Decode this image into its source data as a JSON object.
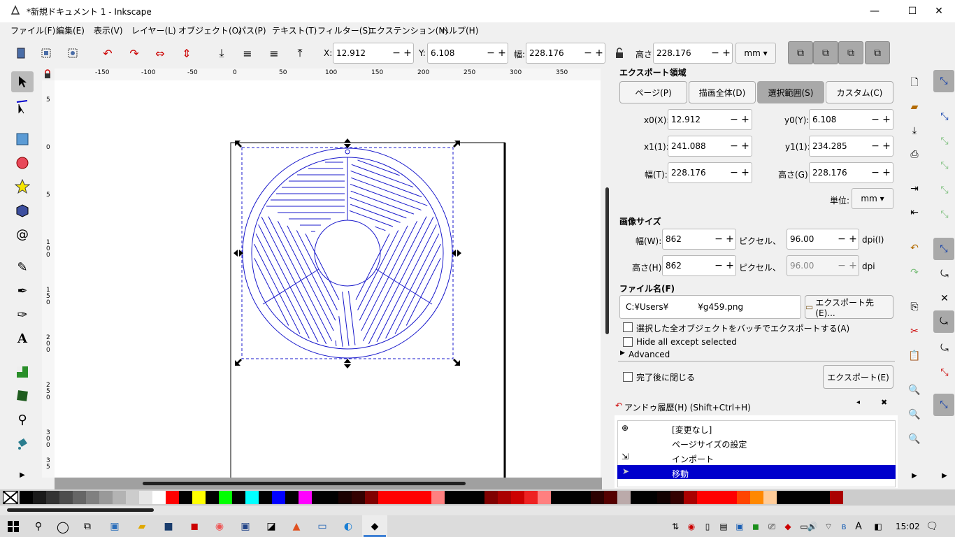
{
  "window": {
    "title": "*新規ドキュメント 1 - Inkscape",
    "minimize": "—",
    "maximize": "☐",
    "close": "✕"
  },
  "menu": [
    "ファイル(F)",
    "編集(E)",
    "表示(V)",
    "レイヤー(L)",
    "オブジェクト(O)",
    "パス(P)",
    "テキスト(T)",
    "フィルター(S)",
    "エクステンション(N)",
    "ヘルプ(H)"
  ],
  "toolbar": {
    "x_label": "X:",
    "x_value": "12.912",
    "y_label": "Y:",
    "y_value": "6.108",
    "w_label": "幅:",
    "w_value": "228.176",
    "h_label": "高さ:",
    "h_value": "228.176",
    "unit": "mm",
    "minus": "−",
    "plus": "+"
  },
  "rulers": {
    "top": [
      "-150",
      "-100",
      "-50",
      "0",
      "50",
      "100",
      "150",
      "200",
      "250",
      "300",
      "350"
    ],
    "left": [
      "5",
      "0",
      "5",
      "1\n0\n0",
      "1\n5\n0",
      "2\n0\n0",
      "2\n5\n0",
      "3\n0\n0",
      "3\n5"
    ]
  },
  "export_dialog": {
    "area_title": "エクスポート領域",
    "area_buttons": [
      "ページ(P)",
      "描画全体(D)",
      "選択範囲(S)",
      "カスタム(C)"
    ],
    "selected_area": "選択範囲(S)",
    "x0_label": "x0(X):",
    "x0_value": "12.912",
    "y0_label": "y0(Y):",
    "y0_value": "6.108",
    "x1_label": "x1(1):",
    "x1_value": "241.088",
    "y1_label": "y1(1):",
    "y1_value": "234.285",
    "width_label": "幅(T):",
    "width_value": "228.176",
    "height_label": "高さ(G):",
    "height_value": "228.176",
    "unit_label": "単位:",
    "unit_value": "mm",
    "image_size_title": "画像サイズ",
    "img_w_label": "幅(W):",
    "img_w_value": "862",
    "px_label_1": "ピクセル、",
    "dpi_value": "96.00",
    "dpi_label": "dpi(I)",
    "img_h_label": "高さ(H):",
    "img_h_value": "862",
    "px_label_2": "ピクセル、",
    "dpi_value_2": "96.00",
    "dpi_label_2": "dpi",
    "filename_title": "ファイル名(F)",
    "filename_value": "C:¥Users¥           ¥g459.png",
    "export_as_button": "エクスポート先(E)...",
    "batch_label": "選択した全オブジェクトをバッチでエクスポートする(A)",
    "hide_label": "Hide all except selected",
    "advanced_label": "Advanced",
    "close_after_label": "完了後に閉じる",
    "export_button": "エクスポート(E)"
  },
  "undo_history": {
    "title": "アンドゥ履歴(H) (Shift+Ctrl+H)",
    "items": [
      "[変更なし]",
      "ページサイズの設定",
      "インポート",
      "移動"
    ],
    "selected_index": 3
  },
  "palette_colors": [
    "#000000",
    "#1a1a1a",
    "#333333",
    "#4d4d4d",
    "#666666",
    "#808080",
    "#999999",
    "#b3b3b3",
    "#cccccc",
    "#e6e6e6",
    "#ffffff",
    "#ff0000",
    "#000000",
    "#ffff00",
    "#000000",
    "#00ff00",
    "#000000",
    "#00ffff",
    "#000000",
    "#0000ff",
    "#000000",
    "#ff00ff",
    "#000000",
    "#000000",
    "#1a0000",
    "#330000",
    "#800000",
    "#ff0000",
    "#ff0000",
    "#ff0000",
    "#ff0000",
    "#ff8080",
    "#000000",
    "#000000",
    "#000000",
    "#800000",
    "#aa0000",
    "#cc0000",
    "#ee2222",
    "#ff8080",
    "#000000",
    "#000000",
    "#000000",
    "#2b0000",
    "#550000",
    "#bbaaaa",
    "#000000",
    "#000000",
    "#110000",
    "#330000",
    "#aa0000",
    "#ff0000",
    "#ff0000",
    "#ff0000",
    "#ff4400",
    "#ff8800",
    "#ffcc99",
    "#000000",
    "#000000",
    "#000000",
    "#000000",
    "#aa0000"
  ],
  "taskbar": {
    "clock": "15:02",
    "ime": "A"
  }
}
